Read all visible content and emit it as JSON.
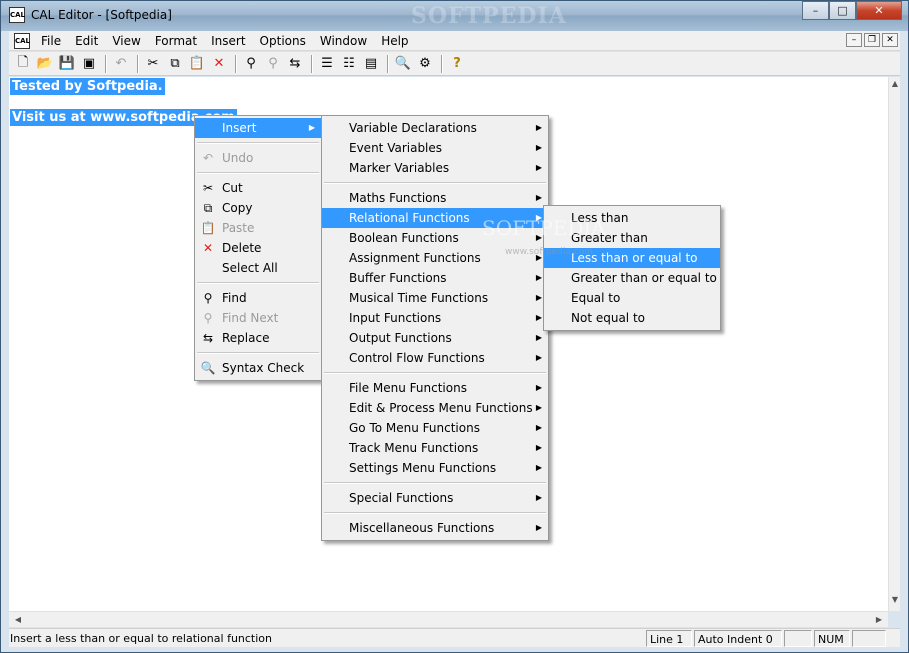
{
  "window": {
    "title": "CAL Editor - [Softpedia]",
    "icon_label": "CAL",
    "watermark": "SOFTPEDIA"
  },
  "window_buttons": {
    "minimize": "–",
    "maximize": "□",
    "close": "✕"
  },
  "menubar": {
    "items": [
      "File",
      "Edit",
      "View",
      "Format",
      "Insert",
      "Options",
      "Window",
      "Help"
    ]
  },
  "mdi_buttons": {
    "minimize": "–",
    "restore": "❐",
    "close": "✕"
  },
  "editor": {
    "lines": [
      "Tested by Softpedia.",
      "Visit us at www.softpedia.com"
    ]
  },
  "context_menu": {
    "insert": "Insert",
    "undo": "Undo",
    "cut": "Cut",
    "copy": "Copy",
    "paste": "Paste",
    "delete": "Delete",
    "select_all": "Select All",
    "find": "Find",
    "find_next": "Find Next",
    "replace": "Replace",
    "syntax_check": "Syntax Check"
  },
  "insert_submenu": {
    "items": [
      "Variable Declarations",
      "Event Variables",
      "Marker Variables",
      "Maths Functions",
      "Relational Functions",
      "Boolean Functions",
      "Assignment Functions",
      "Buffer Functions",
      "Musical Time Functions",
      "Input Functions",
      "Output Functions",
      "Control Flow Functions",
      "File Menu Functions",
      "Edit & Process Menu Functions",
      "Go To Menu Functions",
      "Track Menu Functions",
      "Settings Menu Functions",
      "Special Functions",
      "Miscellaneous Functions"
    ]
  },
  "relational_submenu": {
    "items": [
      "Less than",
      "Greater than",
      "Less than or equal to",
      "Greater than or equal to",
      "Equal to",
      "Not equal to"
    ]
  },
  "overlay_watermark": {
    "big": "SOFTPEDIA",
    "small": "www.softpedia.com"
  },
  "statusbar": {
    "message": "Insert a less than or equal to relational function",
    "line": "Line 1",
    "auto_indent": "Auto Indent 0",
    "num": "NUM"
  }
}
